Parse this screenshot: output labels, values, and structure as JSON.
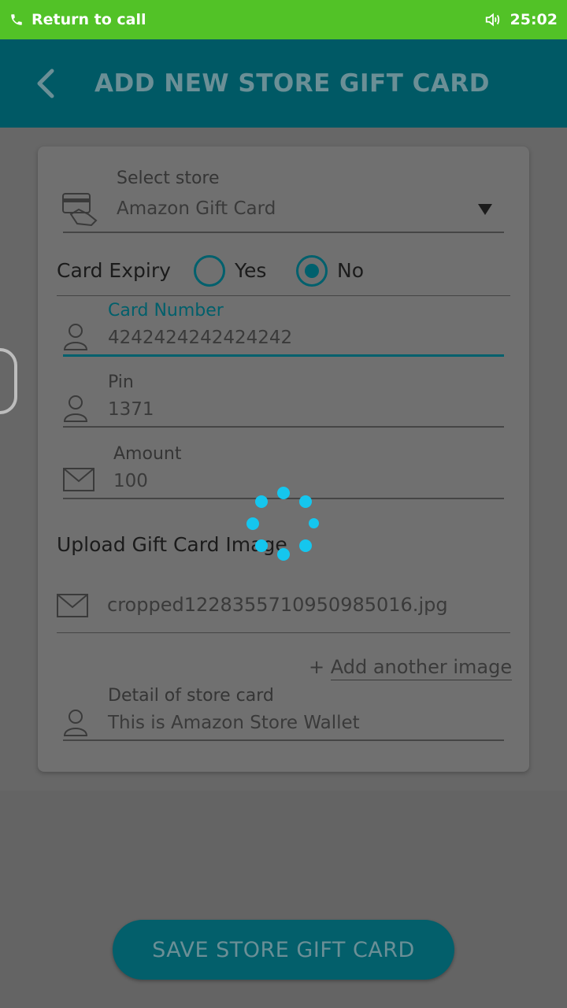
{
  "status_bar": {
    "call_label": "Return to call",
    "time": "25:02",
    "phone_icon": "phone-icon",
    "volume_icon": "volume-icon"
  },
  "app_bar": {
    "title": "ADD NEW STORE GIFT CARD",
    "back_icon": "back-arrow-icon"
  },
  "form": {
    "store": {
      "hint": "Select store",
      "value": "Amazon Gift Card"
    },
    "card_expiry": {
      "label": "Card Expiry",
      "options": [
        "Yes",
        "No"
      ],
      "selected": "No"
    },
    "card_number": {
      "hint": "Card Number",
      "value": "4242424242424242"
    },
    "pin": {
      "hint": "Pin",
      "value": "1371"
    },
    "amount": {
      "hint": "Amount",
      "value": "100"
    },
    "upload": {
      "label": "Upload Gift Card Image",
      "file_name": "cropped1228355710950985016.jpg"
    },
    "add_image": {
      "prefix": "+",
      "label": "Add another image"
    },
    "detail": {
      "hint": "Detail of store card",
      "value": "This is Amazon Store Wallet"
    }
  },
  "save_button": {
    "label": "SAVE STORE GIFT CARD"
  },
  "colors": {
    "status_bar": "#52c227",
    "app_bar": "#005965",
    "accent": "#00606d",
    "spinner": "#15c6ee"
  }
}
